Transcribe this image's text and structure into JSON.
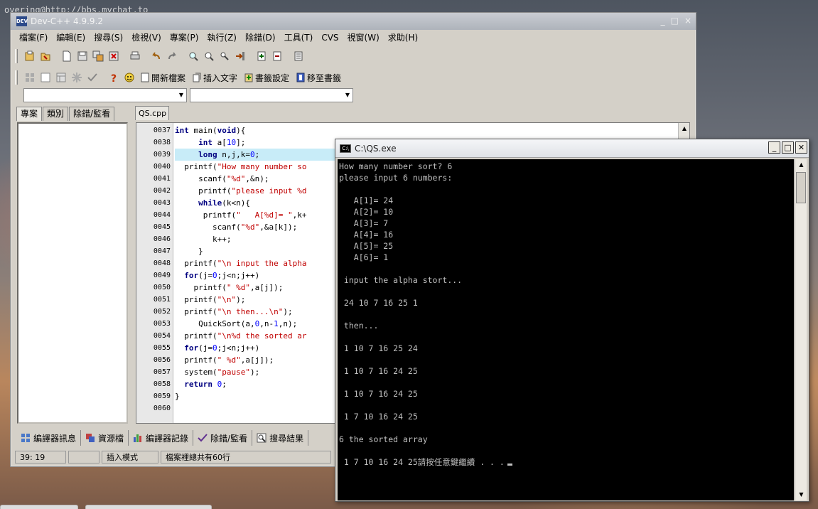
{
  "desktop": {
    "caption": "overing@http://bbs.mychat.to"
  },
  "devcpp": {
    "title": "Dev-C++ 4.9.9.2",
    "window_controls": [
      "_",
      "□",
      "×"
    ],
    "menu": [
      "檔案(F)",
      "編輯(E)",
      "搜尋(S)",
      "檢視(V)",
      "專案(P)",
      "執行(Z)",
      "除錯(D)",
      "工具(T)",
      "CVS",
      "視窗(W)",
      "求助(H)"
    ],
    "toolbar2_labels": {
      "open_file": "開新檔案",
      "insert_text": "插入文字",
      "bookmark_settings": "書籤設定",
      "goto_bookmark": "移至書籤"
    },
    "project_tabs": [
      "專案",
      "類別",
      "除錯/監看"
    ],
    "file_tab": "QS.cpp",
    "bottom_tabs": [
      "編譯器訊息",
      "資源檔",
      "編譯器記錄",
      "除錯/監看",
      "搜尋結果"
    ],
    "status": {
      "position": "39: 19",
      "mode": "插入模式",
      "info": "檔案裡總共有60行"
    },
    "code": [
      {
        "ln": "0037",
        "text": "int main(void){"
      },
      {
        "ln": "0038",
        "text": "     int a[10];"
      },
      {
        "ln": "0039",
        "text": "     long n,j,k=0;"
      },
      {
        "ln": "0040",
        "text": "  printf(\"How many number so"
      },
      {
        "ln": "0041",
        "text": "     scanf(\"%d\",&n);"
      },
      {
        "ln": "0042",
        "text": "     printf(\"please input %d"
      },
      {
        "ln": "0043",
        "text": "     while(k<n){"
      },
      {
        "ln": "0044",
        "text": "      printf(\"   A[%d]= \",k+"
      },
      {
        "ln": "0045",
        "text": "        scanf(\"%d\",&a[k]);"
      },
      {
        "ln": "0046",
        "text": "        k++;"
      },
      {
        "ln": "0047",
        "text": "     }"
      },
      {
        "ln": "0048",
        "text": "  printf(\"\\n input the alpha"
      },
      {
        "ln": "0049",
        "text": "  for(j=0;j<n;j++)"
      },
      {
        "ln": "0050",
        "text": "    printf(\" %d\",a[j]);"
      },
      {
        "ln": "0051",
        "text": "  printf(\"\\n\");"
      },
      {
        "ln": "0052",
        "text": "  printf(\"\\n then...\\n\");"
      },
      {
        "ln": "0053",
        "text": "     QuickSort(a,0,n-1,n);"
      },
      {
        "ln": "0054",
        "text": "  printf(\"\\n%d the sorted ar"
      },
      {
        "ln": "0055",
        "text": "  for(j=0;j<n;j++)"
      },
      {
        "ln": "0056",
        "text": "  printf(\" %d\",a[j]);"
      },
      {
        "ln": "0057",
        "text": "  system(\"pause\");"
      },
      {
        "ln": "0058",
        "text": "  return 0;"
      },
      {
        "ln": "0059",
        "text": "}"
      },
      {
        "ln": "0060",
        "text": ""
      }
    ]
  },
  "console": {
    "title": "C:\\QS.exe",
    "icon_label": "C:\\",
    "lines": [
      "How many number sort? 6",
      "please input 6 numbers:",
      "",
      "   A[1]= 24",
      "   A[2]= 10",
      "   A[3]= 7",
      "   A[4]= 16",
      "   A[5]= 25",
      "   A[6]= 1",
      "",
      " input the alpha stort...",
      "",
      " 24 10 7 16 25 1",
      "",
      " then...",
      "",
      " 1 10 7 16 25 24",
      "",
      " 1 10 7 16 24 25",
      "",
      " 1 10 7 16 24 25",
      "",
      " 1 7 10 16 24 25",
      "",
      "6 the sorted array",
      "",
      " 1 7 10 16 24 25請按任意鍵繼續 . . ."
    ]
  }
}
